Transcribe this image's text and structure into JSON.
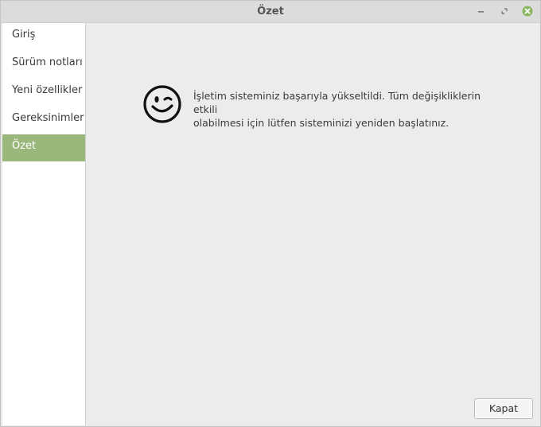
{
  "window": {
    "title": "Özet",
    "controls": {
      "minimize_icon": "minimize-icon",
      "maximize_icon": "maximize-icon",
      "close_icon": "close-icon",
      "close_color": "#8ab661"
    }
  },
  "sidebar": {
    "items": [
      {
        "label": "Giriş",
        "active": false
      },
      {
        "label": "Sürüm notları",
        "active": false
      },
      {
        "label": "Yeni özellikler",
        "active": false
      },
      {
        "label": "Gereksinimler",
        "active": false
      },
      {
        "label": "Özet",
        "active": true
      }
    ],
    "active_color": "#9ab87c"
  },
  "main": {
    "icon": "winking-smiley-icon",
    "message_line1": "İşletim sisteminiz başarıyla yükseltildi. Tüm değişikliklerin etkili",
    "message_line2": "olabilmesi için lütfen sisteminizi yeniden başlatınız."
  },
  "footer": {
    "close_label": "Kapat"
  }
}
